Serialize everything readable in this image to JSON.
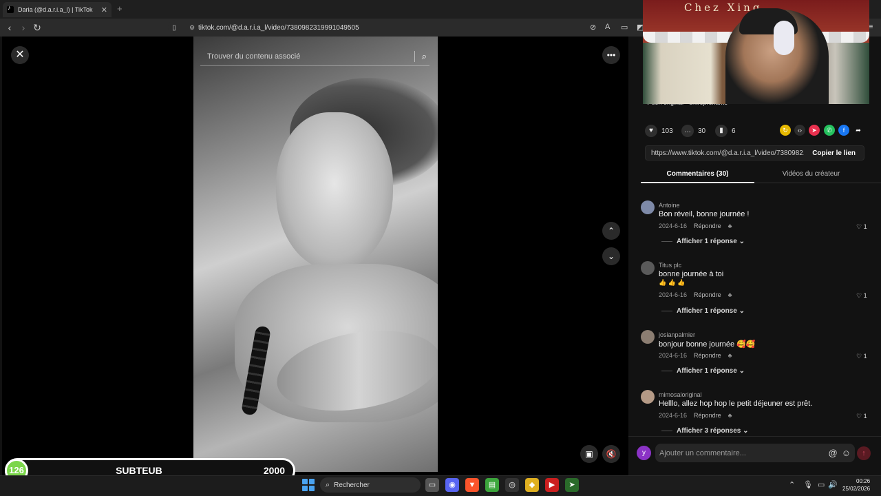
{
  "browser": {
    "tab_title": "Daria (@d.a.r.i.a_l) | TikTok",
    "url": "tiktok.com/@d.a.r.i.a_l/video/7380982319991049505"
  },
  "video": {
    "search_placeholder": "Trouver du contenu associé"
  },
  "cam": {
    "sign_text": "Chez Xing"
  },
  "panel": {
    "sound": "♪ son original - entreprenante",
    "likes": "103",
    "comments": "30",
    "saves": "6",
    "share_url": "https://www.tiktok.com/@d.a.r.i.a_l/video/7380982...",
    "copy_label": "Copier le lien",
    "tab_comments": "Commentaires (30)",
    "tab_videos": "Vidéos du créateur"
  },
  "comments": [
    {
      "user": "Antoine",
      "text": "Bon réveil, bonne journée !",
      "text2": "",
      "date": "2024-6-16",
      "reply": "Répondre",
      "likes": "1",
      "more": "Afficher 1 réponse",
      "avatar_color": "#7e8aa8"
    },
    {
      "user": "Titus plc",
      "text": "bonne journée à toi",
      "text2": "👍 👍 👍",
      "date": "2024-6-16",
      "reply": "Répondre",
      "likes": "1",
      "more": "Afficher 1 réponse",
      "avatar_color": "#5a5a5a"
    },
    {
      "user": "josianpalmier",
      "text": "bonjour bonne journée 🥰🥰",
      "text2": "",
      "date": "2024-6-16",
      "reply": "Répondre",
      "likes": "1",
      "more": "Afficher 1 réponse",
      "avatar_color": "#8c7e72"
    },
    {
      "user": "mimosaloriginal",
      "text": "Helllo, allez hop hop le petit déjeuner est prêt.",
      "text2": "",
      "date": "2024-6-16",
      "reply": "Répondre",
      "likes": "1",
      "more": "Afficher 3 réponses",
      "avatar_color": "#b59a86"
    }
  ],
  "composer": {
    "avatar_letter": "y",
    "placeholder": "Ajouter un commentaire..."
  },
  "overlay": {
    "sub_count": "126",
    "sub_label": "SUBTEUB",
    "sub_goal": "2000"
  },
  "taskbar": {
    "search": "Rechercher",
    "time": "00:26",
    "date": "25/02/2026"
  }
}
